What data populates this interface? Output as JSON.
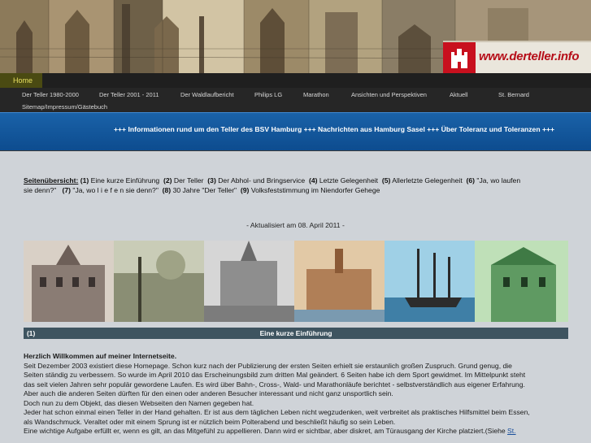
{
  "logo": {
    "text": "www.derteller.info"
  },
  "home_tab": {
    "label": "Home"
  },
  "nav": {
    "items": [
      {
        "label": "Der Teller 1980-2000"
      },
      {
        "label": "Der Teller 2001 - 2011"
      },
      {
        "label": "Der Waldlaufbericht"
      },
      {
        "label": "Philips LG"
      },
      {
        "label": "Marathon"
      },
      {
        "label": "Ansichten und Perspektiven"
      },
      {
        "label": "Aktuell"
      },
      {
        "label": "St. Bernard"
      },
      {
        "label": "Sitemap/Impressum/Gästebuch"
      }
    ]
  },
  "marquee": {
    "text": "+++ Informationen rund um den Teller des BSV Hamburg +++ Nachrichten aus Hamburg Sasel +++ Über Toleranz und Toleranzen +++"
  },
  "index": {
    "label": "Seitenübersicht:",
    "items": [
      {
        "num": "(1)",
        "label": "Eine kurze Einführung"
      },
      {
        "num": "(2)",
        "label": "Der Teller"
      },
      {
        "num": "(3)",
        "label": "Der Abhol- und Bringservice"
      },
      {
        "num": "(4)",
        "label": "Letzte Gelegenheit"
      },
      {
        "num": "(5)",
        "label": "Allerletzte Gelegenheit"
      },
      {
        "num": "(6)",
        "label": "\"Ja, wo laufen"
      },
      {
        "cont": "sie denn?\""
      },
      {
        "num": "(7)",
        "label": "\"Ja, wo   l i e f e n sie denn?\""
      },
      {
        "num": "(8)",
        "label": "30 Jahre \"Der Teller\""
      },
      {
        "num": "(9)",
        "label": "Volksfeststimmung im Niendorfer Gehege"
      }
    ]
  },
  "updated": {
    "text": "- Aktualisiert am 08. April 2011 -"
  },
  "section": {
    "num": "(1)",
    "title": "Eine kurze Einführung"
  },
  "text": {
    "heading": "Herzlich Willkommen auf meiner Internetseite.",
    "lines": [
      "Seit Dezember 2003 existiert diese Homepage. Schon kurz nach der Publizierung der ersten Seiten erhielt sie erstaunlich großen Zuspruch. Grund genug, die",
      "Seiten ständig zu verbessern. So wurde im April 2010 das Erscheinungsbild zum dritten Mal geändert. 6 Seiten habe ich dem Sport gewidmet. Im Mittelpunkt steht",
      "das seit vielen Jahren sehr populär gewordene Laufen. Es wird über Bahn-, Cross-, Wald- und Marathonläufe berichtet - selbstverständlich aus eigener Erfahrung.",
      "Aber auch die anderen Seiten dürften für den einen oder anderen Besucher interessant und nicht ganz unsportlich sein.",
      "Doch nun zu dem Objekt, das diesen Webseiten den Namen gegeben hat.",
      "Jeder hat schon einmal einen Teller in der Hand gehalten. Er ist aus dem täglichen Leben nicht wegzudenken, weit verbreitet als praktisches Hilfsmittel beim Essen,",
      "als Wandschmuck. Veraltet oder mit einem Sprung ist er nützlich beim Polterabend und beschließt häufig so sein Leben."
    ],
    "last_line": "Eine wichtige Aufgabe erfüllt er, wenn es gilt, an das Mitgefühl zu appellieren. Dann wird er sichtbar, aber diskret, am Türausgang der Kirche platziert.(Siehe",
    "last_link": "St."
  },
  "colors": {
    "marquee_bg": "#0d4c8f",
    "section_bar": "#3e5460",
    "content_bg": "#cfd3d8",
    "logo_red": "#c8101e"
  }
}
